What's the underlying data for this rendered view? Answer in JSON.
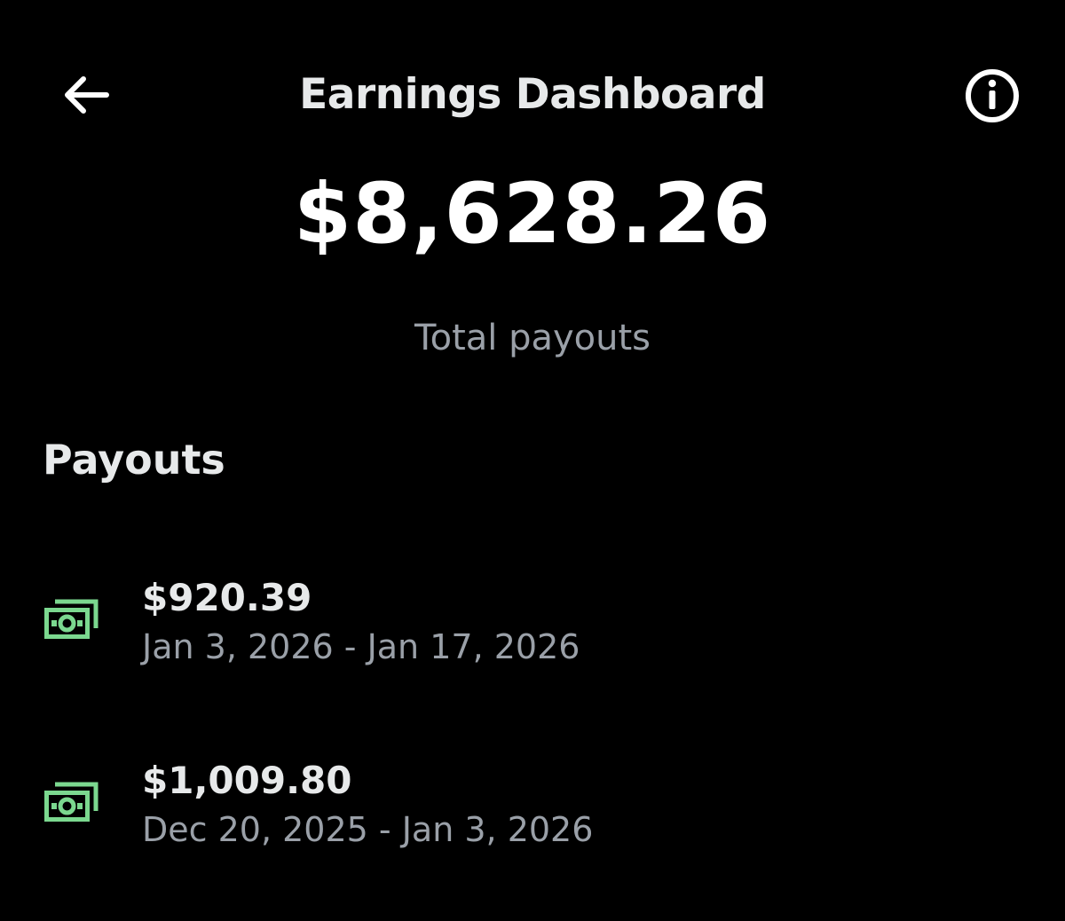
{
  "header": {
    "title": "Earnings Dashboard",
    "back_icon": "arrow-left-icon",
    "info_icon": "info-circle-icon"
  },
  "summary": {
    "total_amount": "$8,628.26",
    "total_label": "Total payouts"
  },
  "payouts": {
    "section_title": "Payouts",
    "icon": "money-bills-icon",
    "icon_color": "#7bd88f",
    "items": [
      {
        "amount": "$920.39",
        "dates": "Jan 3, 2026 - Jan 17, 2026"
      },
      {
        "amount": "$1,009.80",
        "dates": "Dec 20, 2025 - Jan 3, 2026"
      }
    ]
  },
  "colors": {
    "background": "#000000",
    "text_primary": "#e7e9ea",
    "text_secondary": "#9aa0a8",
    "accent_green": "#7bd88f"
  }
}
